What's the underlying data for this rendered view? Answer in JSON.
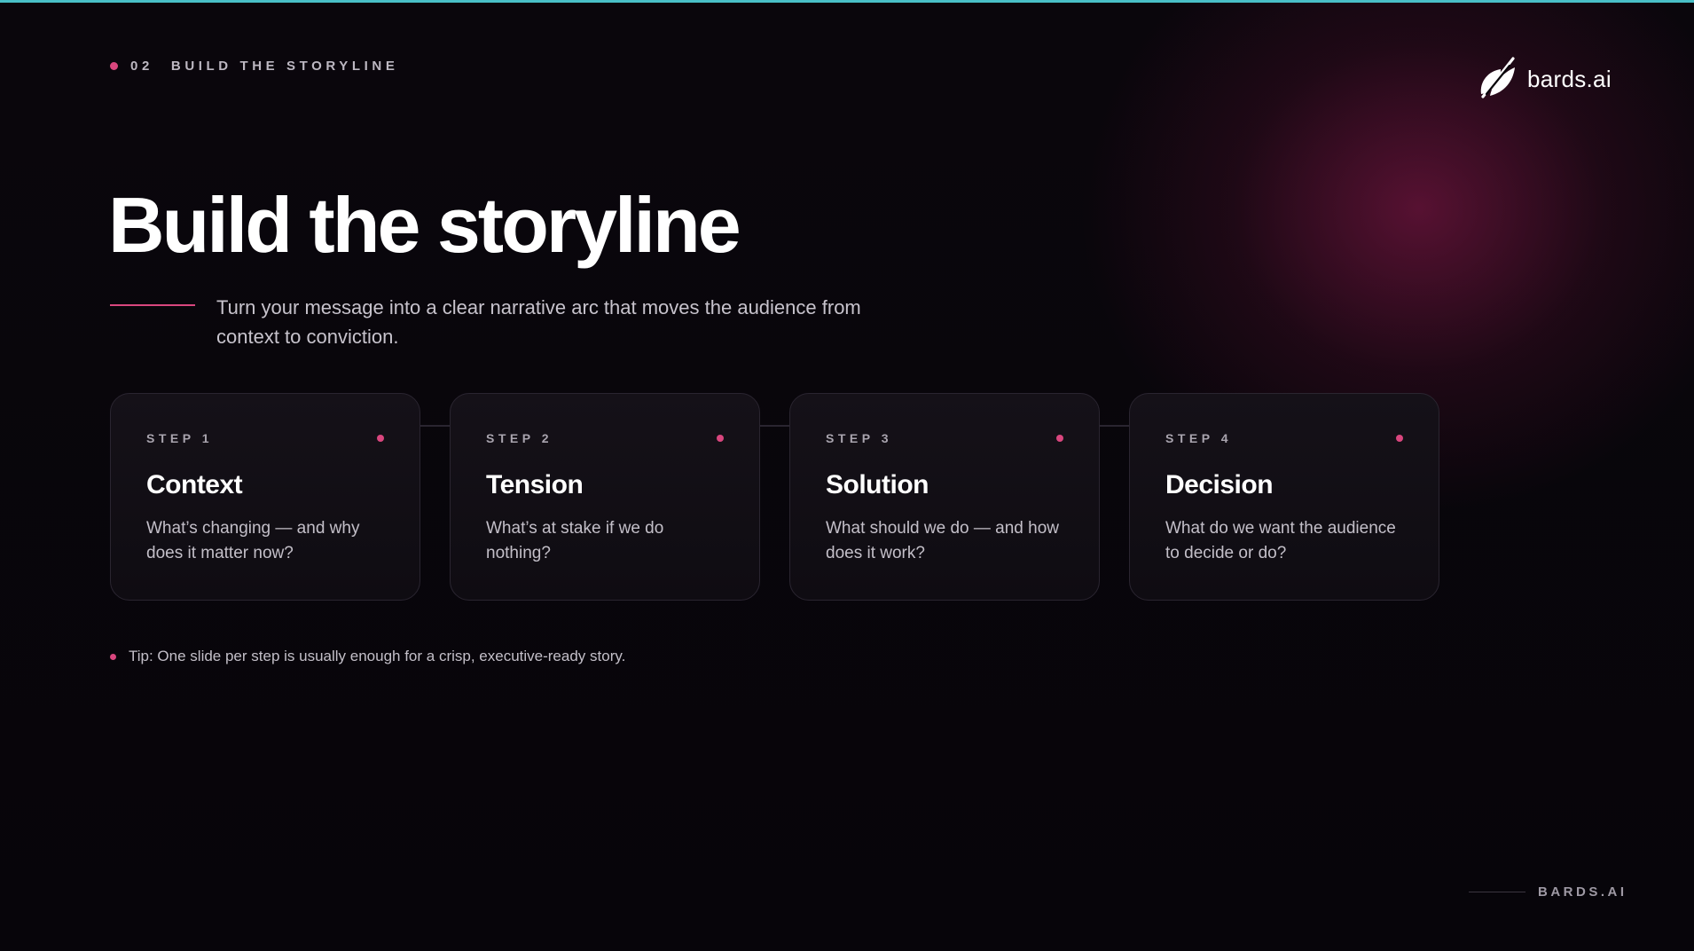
{
  "header": {
    "section_number": "02",
    "section_title": "BUILD THE STORYLINE"
  },
  "brand": {
    "logo_icon": "feather-quill-icon",
    "name": "bards.ai",
    "footer_label": "BARDS.AI"
  },
  "main": {
    "title": "Build the storyline",
    "subtitle": "Turn your message into a clear narrative arc that moves the audience from context to conviction."
  },
  "steps": [
    {
      "label": "STEP 1",
      "title": "Context",
      "description": "What’s changing — and why does it matter now?"
    },
    {
      "label": "STEP 2",
      "title": "Tension",
      "description": "What’s at stake if we do nothing?"
    },
    {
      "label": "STEP 3",
      "title": "Solution",
      "description": "What should we do — and how does it work?"
    },
    {
      "label": "STEP 4",
      "title": "Decision",
      "description": "What do we want the audience to decide or do?"
    }
  ],
  "tip": "Tip: One slide per step is usually enough for a crisp, executive-ready story.",
  "colors": {
    "accent": "#d9467e",
    "top_bar": "#49bfc7",
    "background": "#08050a",
    "glow": "#78163e"
  }
}
